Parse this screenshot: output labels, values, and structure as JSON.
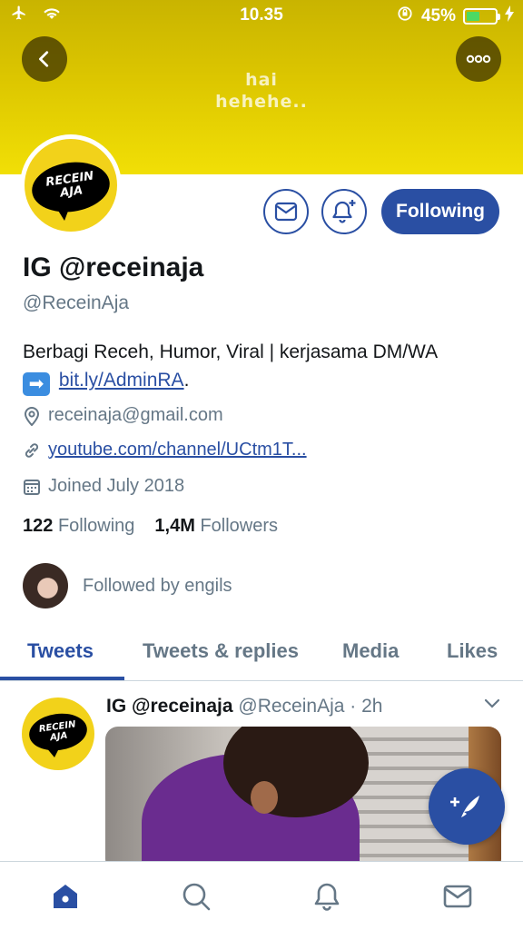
{
  "status_bar": {
    "time": "10.35",
    "battery_percent": "45%",
    "battery_level": 0.45
  },
  "header": {
    "banner_text_line1": "hai",
    "banner_text_line2": "hehehe..",
    "banner_color": "#dcc600"
  },
  "avatar": {
    "logo_line1": "RECEIN",
    "logo_line2": "AJA"
  },
  "actions": {
    "following_label": "Following"
  },
  "profile": {
    "name": "IG @receinaja",
    "handle": "@ReceinAja",
    "bio_text": "Berbagi Receh, Humor, Viral | kerjasama DM/WA",
    "bio_emoji": "➡",
    "bio_link": "bit.ly/AdminRA",
    "bio_end": ".",
    "location": "receinaja@gmail.com",
    "website": "youtube.com/channel/UCtm1T...",
    "joined": "Joined July 2018",
    "following_count": "122",
    "following_label": "Following",
    "followers_count": "1,4M",
    "followers_label": "Followers",
    "followed_by": "Followed by engils"
  },
  "tabs": [
    {
      "label": "Tweets"
    },
    {
      "label": "Tweets & replies"
    },
    {
      "label": "Media"
    },
    {
      "label": "Likes"
    }
  ],
  "tweet": {
    "author_name": "IG @receinaja",
    "author_handle": "@ReceinAja",
    "separator": "·",
    "time": "2h"
  },
  "colors": {
    "accent": "#2a4fa3",
    "muted": "#657786"
  },
  "icons": {
    "compose": "feather-plus-icon",
    "home": "home-icon",
    "search": "search-icon",
    "notifications": "bell-icon",
    "messages": "envelope-icon"
  }
}
